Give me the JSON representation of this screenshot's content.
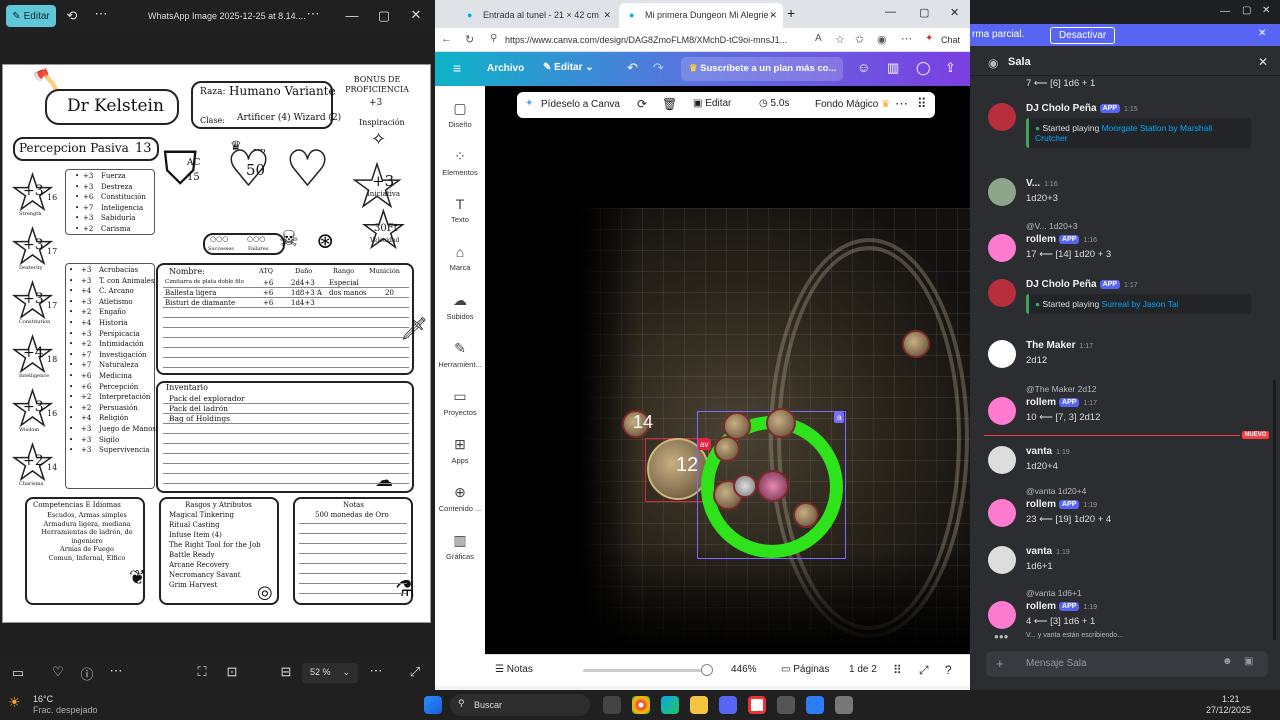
{
  "photos": {
    "edit_label": "Editar",
    "window_title": "WhatsApp Image 2025-12-25 at 8.14....",
    "zoom": "52 %",
    "sheet": {
      "name": "Dr Kelstein",
      "bonus_label": "BONUS DE PROFICIENCIA",
      "bonus_value": "+3",
      "race_label": "Raza:",
      "race_value": "Humano Variante",
      "class_label": "Clase:",
      "class_value": "Artificer (4) Wizard (2)",
      "inspiration": "Inspiración",
      "passive_label": "Percepcion Pasiva",
      "passive_value": "13",
      "ac_label": "AC",
      "ac_value": "15",
      "hp_label": "HP",
      "hp_value": "50",
      "initiative_value": "+3",
      "initiative_label": "Iniciativa",
      "speed_value": "30Ft",
      "speed_label": "Velocidad",
      "successes": "Successes",
      "failures": "Failures",
      "abilities": [
        {
          "mod": "+3",
          "score": "16",
          "name": "Strength"
        },
        {
          "mod": "+3",
          "score": "17",
          "name": "Dexterity"
        },
        {
          "mod": "+3",
          "score": "17",
          "name": "Constitution"
        },
        {
          "mod": "+4",
          "score": "18",
          "name": "Intelligence"
        },
        {
          "mod": "+3",
          "score": "16",
          "name": "Wisdom"
        },
        {
          "mod": "+2",
          "score": "14",
          "name": "Charisma"
        }
      ],
      "saves": [
        {
          "v": "+3",
          "n": "Fuerza"
        },
        {
          "v": "+3",
          "n": "Destreza"
        },
        {
          "v": "+6",
          "n": "Constitución"
        },
        {
          "v": "+7",
          "n": "Inteligencia"
        },
        {
          "v": "+3",
          "n": "Sabiduría"
        },
        {
          "v": "+2",
          "n": "Carisma"
        }
      ],
      "skills": [
        {
          "v": "+3",
          "n": "Acrobacias"
        },
        {
          "v": "+3",
          "n": "T. con Animales"
        },
        {
          "v": "+4",
          "n": "C. Arcano"
        },
        {
          "v": "+3",
          "n": "Atletismo"
        },
        {
          "v": "+2",
          "n": "Engaño"
        },
        {
          "v": "+4",
          "n": "Historia"
        },
        {
          "v": "+3",
          "n": "Perspicacia"
        },
        {
          "v": "+2",
          "n": "Intimidación"
        },
        {
          "v": "+7",
          "n": "Investigación"
        },
        {
          "v": "+7",
          "n": "Naturaleza"
        },
        {
          "v": "+6",
          "n": "Medicina"
        },
        {
          "v": "+6",
          "n": "Percepción"
        },
        {
          "v": "+2",
          "n": "Interpretación"
        },
        {
          "v": "+2",
          "n": "Persuasión"
        },
        {
          "v": "+4",
          "n": "Religión"
        },
        {
          "v": "+3",
          "n": "Juego de Manos"
        },
        {
          "v": "+3",
          "n": "Sigilo"
        },
        {
          "v": "+3",
          "n": "Supervivencia"
        }
      ],
      "attack_headers": [
        "Nombre:",
        "ATQ",
        "Daño",
        "Rango",
        "Munición"
      ],
      "attacks": [
        {
          "name": "Cimitarra de plata doble filo",
          "atk": "+6",
          "dmg": "2d4+3",
          "range": "Especial",
          "ammo": ""
        },
        {
          "name": "Ballesta ligera",
          "atk": "+6",
          "dmg": "1d8+3 A",
          "range": "dos manos",
          "ammo": "20"
        },
        {
          "name": "Bisturi de diamante",
          "atk": "+6",
          "dmg": "1d4+3",
          "range": "",
          "ammo": ""
        }
      ],
      "inventory_title": "Inventario",
      "inventory": [
        "Pack del explorador",
        "Pack del ladrón",
        "Bag of Holdings"
      ],
      "prof_title": "Competencias E Idiomas",
      "prof": [
        "Escudos, Armas simples",
        "Armadura ligera, mediana",
        "Herramientas de ladrón, de",
        "ingeniero",
        "Armas de Fuego",
        "Comun, Infernal, Elfico"
      ],
      "traits_title": "Rasgos y Atributos",
      "traits": [
        "Magical Tinkering",
        "Ritual Casting",
        "Infuse Item (4)",
        "The Right Tool for the Job",
        "Battle Ready",
        "Arcane Recovery",
        "Necromancy Savant",
        "Grim Harvest"
      ],
      "notes_title": "Notas",
      "notes": [
        "500 monedas de Oro"
      ]
    }
  },
  "browser": {
    "tab1": "Entrada al tunel - 21 × 42 cm",
    "tab2": "Mi primera Dungeon Mi Alegrie -",
    "url": "https://www.canva.com/design/DAG8ZmoFLM8/XMchD-tC9oi-mnsJ1...",
    "chat": "Chat",
    "canva": {
      "archivo": "Archivo",
      "editar": "Editar",
      "subscribe": "Suscríbete a un plan más co...",
      "side": [
        "Diseño",
        "Elementos",
        "Texto",
        "Marca",
        "Subidos",
        "Herramient...",
        "Proyectos",
        "Apps",
        "Contenido ...",
        "Gráficas"
      ],
      "toolbar": {
        "ask": "Pídeselo a Canva",
        "edit": "Editar",
        "time": "5.0s",
        "bg": "Fondo Mágico"
      },
      "token_a": "14",
      "token_b": "12",
      "tag_av": "av",
      "tag_a": "a",
      "notes": "Notas",
      "zoom": "446%",
      "pages": "Páginas",
      "page_of": "1 de 2"
    }
  },
  "discord": {
    "banner_text": "rma parcial.",
    "banner_btn": "Desactivar",
    "channel": "Sala",
    "messages": [
      {
        "type": "cont",
        "text": "7  ⟵ [6] 1d6 + 1"
      },
      {
        "type": "msg",
        "name": "DJ Cholo Peña",
        "app": "APP",
        "time": "1:15",
        "embed_pre": "Started playing ",
        "embed_link": "Moorgate Station by Marshall Crutcher"
      },
      {
        "type": "msg",
        "name": "V...",
        "time": "1:16",
        "text": "1d20+3"
      },
      {
        "type": "reply",
        "ref": "@V... 1d20+3",
        "name": "rollem",
        "app": "APP",
        "time": "1:16",
        "text": "17  ⟵ [14] 1d20 + 3"
      },
      {
        "type": "msg",
        "name": "DJ Cholo Peña",
        "app": "APP",
        "time": "1:17",
        "embed_pre": "Started playing ",
        "embed_link": "Surreal by Jason Tai"
      },
      {
        "type": "msg",
        "name": "The Maker",
        "time": "1:17",
        "text": "2d12"
      },
      {
        "type": "reply",
        "ref": "@The Maker 2d12",
        "name": "rollem",
        "app": "APP",
        "time": "1:17",
        "text": "10  ⟵ [7, 3] 2d12"
      },
      {
        "type": "msg",
        "name": "vanta",
        "time": "1:19",
        "text": "1d20+4"
      },
      {
        "type": "reply",
        "ref": "@vanta 1d20+4",
        "name": "rollem",
        "app": "APP",
        "time": "1:19",
        "text": "23  ⟵ [19] 1d20 + 4"
      },
      {
        "type": "msg",
        "name": "vanta",
        "time": "1:19",
        "text": "1d6+1"
      },
      {
        "type": "reply",
        "ref": "@vanta 1d6+1",
        "name": "rollem",
        "app": "APP",
        "time": "1:19",
        "text": "4  ⟵ [3] 1d6 + 1"
      }
    ],
    "new_label": "NUEVO",
    "typing": "V... y vanta están escribiendo...",
    "input_placeholder": "Mensaje Sala"
  },
  "taskbar": {
    "weather_temp": "16°C",
    "weather_desc": "Frac. despejado",
    "search": "Buscar",
    "time": "1:21",
    "date": "27/12/2025"
  }
}
